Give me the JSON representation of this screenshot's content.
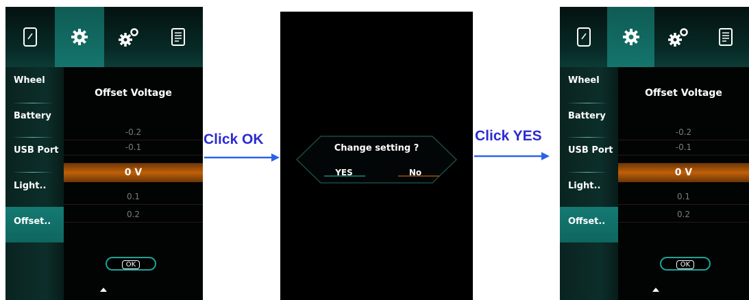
{
  "tab_icons": [
    "phone-icon",
    "gear-icon",
    "gears-icon",
    "document-icon"
  ],
  "sidebar": {
    "items": [
      {
        "label": "Wheel"
      },
      {
        "label": "Battery"
      },
      {
        "label": "USB Port"
      },
      {
        "label": "Light.."
      },
      {
        "label": "Offset.."
      }
    ],
    "selected": "Offset.."
  },
  "offset_panel": {
    "title": "Offset Voltage",
    "values_above": [
      "-0.2",
      "-0.1"
    ],
    "selected_value": "0  V",
    "values_below": [
      "0.1",
      "0.2"
    ],
    "ok_label": "OK"
  },
  "dialog": {
    "title": "Change setting ?",
    "yes_label": "YES",
    "no_label": "No"
  },
  "annotations": {
    "step1": "Click OK",
    "step2": "Click YES"
  },
  "colors": {
    "accent_teal": "#14756d",
    "selection_orange": "#c06008",
    "caption_blue": "#2b2cd1"
  }
}
